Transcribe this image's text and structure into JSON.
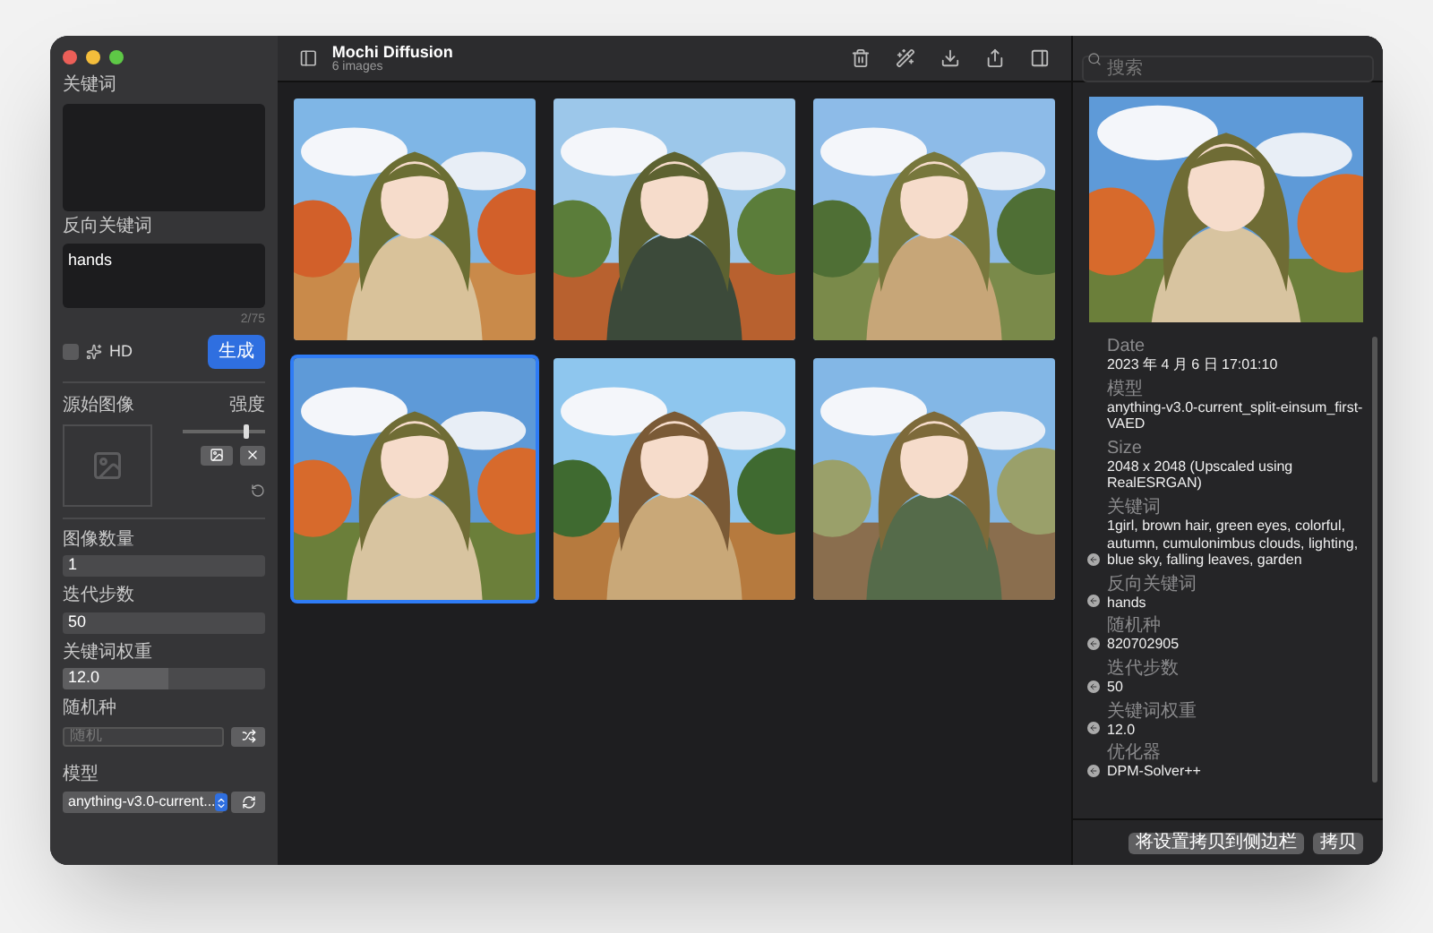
{
  "window": {
    "title": "Mochi Diffusion",
    "subtitle": "6 images"
  },
  "sidebar": {
    "prompt": {
      "label": "关键词"
    },
    "negative_prompt": {
      "label": "反向关键词",
      "value": "hands",
      "counter": "2/75"
    },
    "hd": {
      "label": "HD",
      "checked": false
    },
    "generate_button": "生成",
    "source_image": {
      "label": "源始图像",
      "strength_label": "强度",
      "level": 0.75
    },
    "fields": [
      {
        "label": "图像数量",
        "value": "1",
        "kind": "stepper"
      },
      {
        "label": "迭代步数",
        "value": "50",
        "kind": "stepper"
      },
      {
        "label": "关键词权重",
        "value": "12.0",
        "kind": "slider",
        "level": 0.52
      }
    ],
    "seed": {
      "label": "随机种",
      "placeholder": "随机"
    },
    "model": {
      "label": "模型",
      "value": "anything-v3.0-current..."
    }
  },
  "search": {
    "placeholder": "搜索"
  },
  "images": [
    {
      "selected": false
    },
    {
      "selected": false
    },
    {
      "selected": false
    },
    {
      "selected": true
    },
    {
      "selected": false
    },
    {
      "selected": false
    }
  ],
  "info": [
    {
      "label": "Date",
      "value": "2023 年 4 月 6 日 17:01:10",
      "copy": false
    },
    {
      "label": "模型",
      "value": "anything-v3.0-current_split-einsum_first-VAED",
      "copy": false
    },
    {
      "label": "Size",
      "value": "2048 x 2048 (Upscaled using RealESRGAN)",
      "copy": false
    },
    {
      "label": "关键词",
      "value": "1girl, brown hair, green eyes, colorful, autumn, cumulonimbus clouds, lighting, blue sky, falling leaves, garden",
      "copy": true
    },
    {
      "label": "反向关键词",
      "value": "hands",
      "copy": true
    },
    {
      "label": "随机种",
      "value": "820702905",
      "copy": true
    },
    {
      "label": "迭代步数",
      "value": "50",
      "copy": true
    },
    {
      "label": "关键词权重",
      "value": "12.0",
      "copy": true
    },
    {
      "label": "优化器",
      "value": "DPM-Solver++",
      "copy": true
    }
  ],
  "info_buttons": [
    "将设置拷贝到侧边栏",
    "拷贝"
  ]
}
